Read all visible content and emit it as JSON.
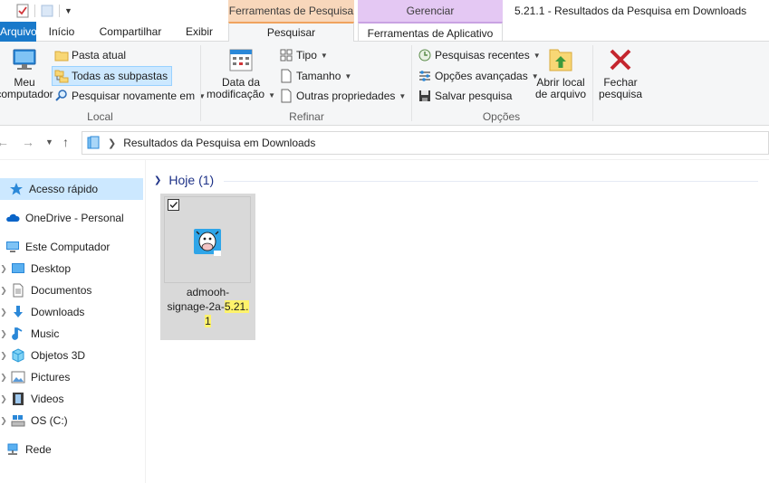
{
  "window": {
    "title": "5.21.1 - Resultados da Pesquisa em Downloads",
    "context_search_label": "Ferramentas de Pesquisa",
    "context_manage_label": "Gerenciar"
  },
  "tabs": {
    "file": "Arquivo",
    "home": "Início",
    "share": "Compartilhar",
    "view": "Exibir",
    "search": "Pesquisar",
    "app_tools": "Ferramentas de Aplicativo"
  },
  "ribbon": {
    "local": {
      "label": "Local",
      "computer_line1": "Meu",
      "computer_line2": "computador",
      "current_folder": "Pasta atual",
      "all_subfolders": "Todas as subpastas",
      "search_again": "Pesquisar novamente em"
    },
    "refine": {
      "label": "Refinar",
      "date_line1": "Data da",
      "date_line2": "modificação",
      "type": "Tipo",
      "size": "Tamanho",
      "other_props": "Outras propriedades"
    },
    "options": {
      "label": "Opções",
      "recent": "Pesquisas recentes",
      "advanced": "Opções avançadas",
      "save": "Salvar pesquisa",
      "open_loc_line1": "Abrir local",
      "open_loc_line2": "de arquivo",
      "close_line1": "Fechar",
      "close_line2": "pesquisa"
    }
  },
  "address": {
    "path": "Resultados da Pesquisa em Downloads"
  },
  "nav": {
    "items": [
      {
        "label": "Acesso rápido",
        "icon": "star-icon"
      },
      {
        "label": "OneDrive - Personal",
        "icon": "cloud-icon"
      },
      {
        "label": "Este Computador",
        "icon": "computer-icon"
      },
      {
        "label": "Desktop",
        "icon": "desktop-icon"
      },
      {
        "label": "Documentos",
        "icon": "documents-icon"
      },
      {
        "label": "Downloads",
        "icon": "download-icon"
      },
      {
        "label": "Music",
        "icon": "music-icon"
      },
      {
        "label": "Objetos 3D",
        "icon": "cube-icon"
      },
      {
        "label": "Pictures",
        "icon": "pictures-icon"
      },
      {
        "label": "Videos",
        "icon": "videos-icon"
      },
      {
        "label": "OS (C:)",
        "icon": "drive-icon"
      },
      {
        "label": "Rede",
        "icon": "network-icon"
      }
    ]
  },
  "content": {
    "group_header": "Hoje (1)",
    "file": {
      "name_part1": "admooh-",
      "name_part2": "signage-2a-",
      "name_highlight1": "5.21.",
      "name_highlight2": "1"
    }
  },
  "colors": {
    "accent": "#1979ca",
    "search_context": "#f8d7bb",
    "manage_context": "#e4c8f3",
    "selection": "#cce8ff",
    "highlight": "#fff36b"
  }
}
